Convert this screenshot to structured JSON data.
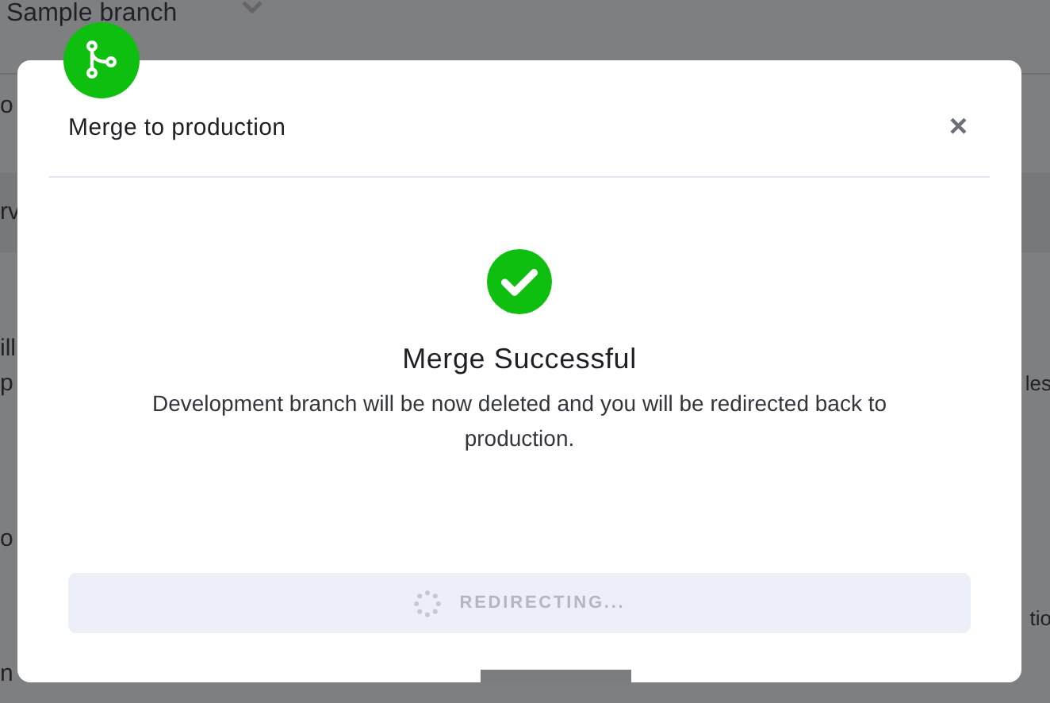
{
  "background": {
    "branch_selector": "Sample branch",
    "fragments_left": [
      "o",
      "rv",
      "ill",
      "p",
      "o",
      "n"
    ],
    "fragments_right": [
      "les",
      "tio"
    ]
  },
  "modal": {
    "title": "Merge to production",
    "close": "×",
    "status": {
      "kind": "success",
      "heading": "Merge Successful",
      "message": "Development branch will be now deleted and you will be redirected back to production."
    },
    "button": {
      "label": "REDIRECTING...",
      "loading": true,
      "disabled": true
    }
  }
}
